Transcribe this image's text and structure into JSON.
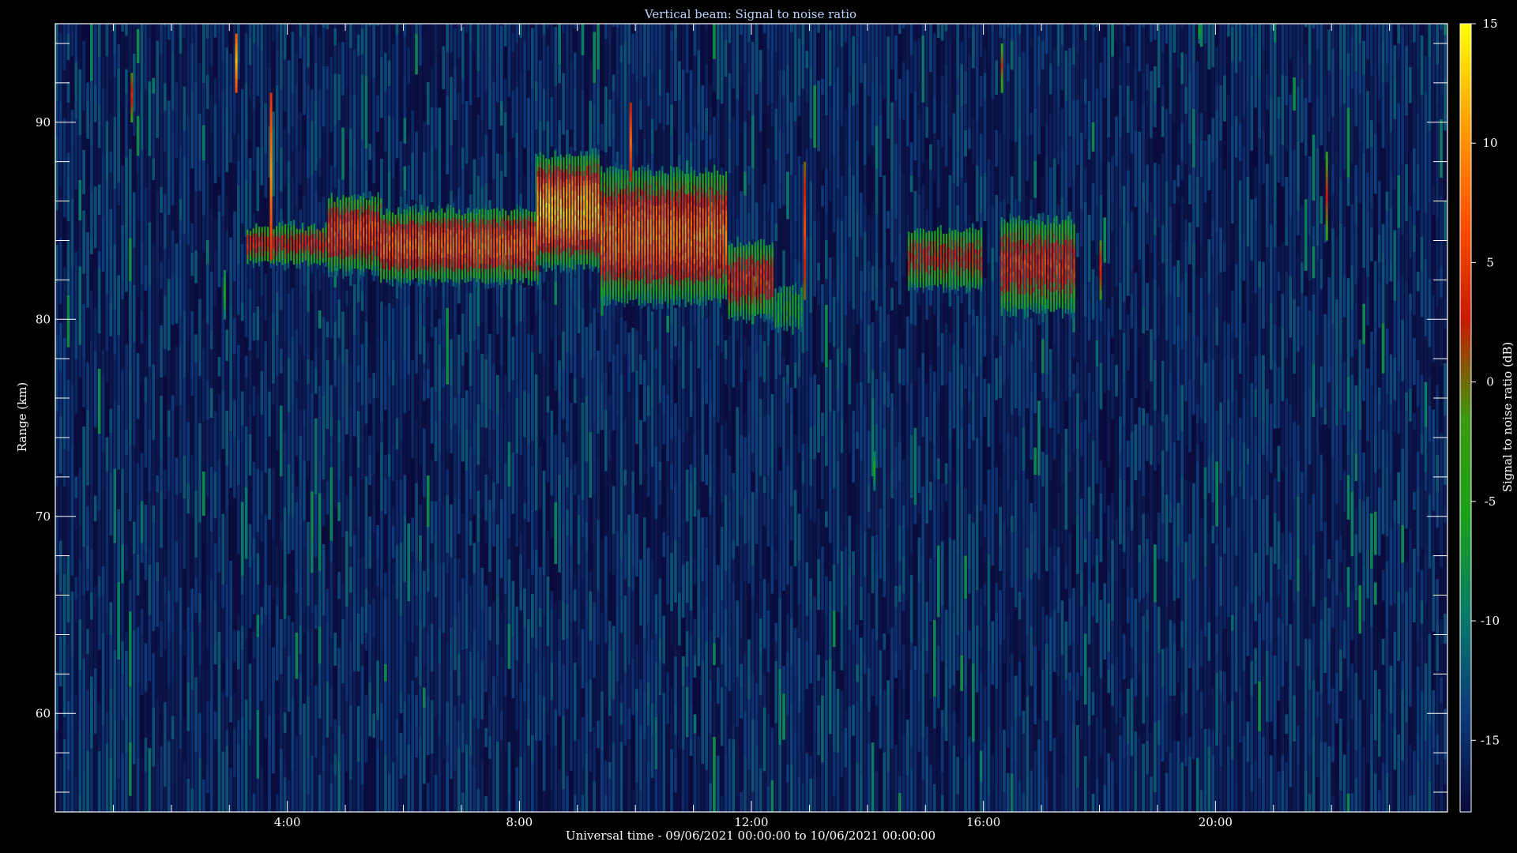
{
  "chart_data": {
    "type": "heatmap",
    "title": "Vertical beam: Signal to noise ratio",
    "xlabel": "Universal time - 09/06/2021 00:00:00 to 10/06/2021 00:00:00",
    "ylabel": "Range (km)",
    "colorbar_label": "Signal to noise ratio (dB)",
    "xlim": [
      0,
      24
    ],
    "ylim": [
      55,
      95
    ],
    "x_ticks": [
      {
        "value": 4,
        "label": "4:00"
      },
      {
        "value": 8,
        "label": "8:00"
      },
      {
        "value": 12,
        "label": "12:00"
      },
      {
        "value": 16,
        "label": "16:00"
      },
      {
        "value": 20,
        "label": "20:00"
      }
    ],
    "y_ticks": [
      {
        "value": 60,
        "label": "60"
      },
      {
        "value": 70,
        "label": "70"
      },
      {
        "value": 80,
        "label": "80"
      },
      {
        "value": 90,
        "label": "90"
      }
    ],
    "colorbar_range": [
      -18,
      15
    ],
    "colorbar_ticks": [
      {
        "value": 15,
        "label": "15"
      },
      {
        "value": 10,
        "label": "10"
      },
      {
        "value": 5,
        "label": "5"
      },
      {
        "value": 0,
        "label": "0"
      },
      {
        "value": -5,
        "label": "-5"
      },
      {
        "value": -10,
        "label": "-10"
      },
      {
        "value": -15,
        "label": "-15"
      }
    ],
    "colormap": [
      "#0a0a3a",
      "#0c3a7a",
      "#0a7a6a",
      "#1aa01a",
      "#3c9a10",
      "#c81a00",
      "#ff5000",
      "#ffa000",
      "#ffff00"
    ],
    "layers": [
      {
        "t_start": 3.3,
        "t_end": 4.7,
        "z_low": 82.7,
        "z_high": 84.7,
        "peak_snr": 3
      },
      {
        "t_start": 4.7,
        "t_end": 5.6,
        "z_low": 82.3,
        "z_high": 86.2,
        "peak_snr": 6
      },
      {
        "t_start": 5.6,
        "t_end": 8.3,
        "z_low": 81.8,
        "z_high": 85.5,
        "peak_snr": 7
      },
      {
        "t_start": 8.3,
        "t_end": 9.4,
        "z_low": 82.5,
        "z_high": 88.3,
        "peak_snr": 11
      },
      {
        "t_start": 9.4,
        "t_end": 11.6,
        "z_low": 80.8,
        "z_high": 87.5,
        "peak_snr": 8
      },
      {
        "t_start": 11.6,
        "t_end": 12.4,
        "z_low": 80.0,
        "z_high": 83.8,
        "peak_snr": 4
      },
      {
        "t_start": 12.4,
        "t_end": 12.9,
        "z_low": 79.5,
        "z_high": 81.5,
        "peak_snr": -6
      },
      {
        "t_start": 14.7,
        "t_end": 16.0,
        "z_low": 81.5,
        "z_high": 84.5,
        "peak_snr": 2
      },
      {
        "t_start": 16.3,
        "t_end": 17.6,
        "z_low": 80.3,
        "z_high": 85.0,
        "peak_snr": 4
      }
    ],
    "spikes": [
      {
        "t": 1.3,
        "z_low": 90.0,
        "z_high": 92.5,
        "snr": 4
      },
      {
        "t": 3.1,
        "z_low": 91.5,
        "z_high": 94.5,
        "snr": 12
      },
      {
        "t": 3.7,
        "z_low": 83.0,
        "z_high": 91.5,
        "snr": 10
      },
      {
        "t": 9.9,
        "z_low": 87.0,
        "z_high": 90.8,
        "snr": 8
      },
      {
        "t": 12.9,
        "z_low": 81.0,
        "z_high": 88.0,
        "snr": 6
      },
      {
        "t": 16.3,
        "z_low": 91.5,
        "z_high": 94.0,
        "snr": 2
      },
      {
        "t": 18.0,
        "z_low": 81.0,
        "z_high": 84.0,
        "snr": 4
      },
      {
        "t": 21.9,
        "z_low": 84.0,
        "z_high": 88.3,
        "snr": 3
      },
      {
        "t": 14.1,
        "z_low": 71.3,
        "z_high": 73.3,
        "snr": -5
      },
      {
        "t": 2.9,
        "z_low": 80.0,
        "z_high": 82.5,
        "snr": -4
      },
      {
        "t": 19.7,
        "z_low": 94.0,
        "z_high": 95.0,
        "snr": -5
      }
    ]
  }
}
